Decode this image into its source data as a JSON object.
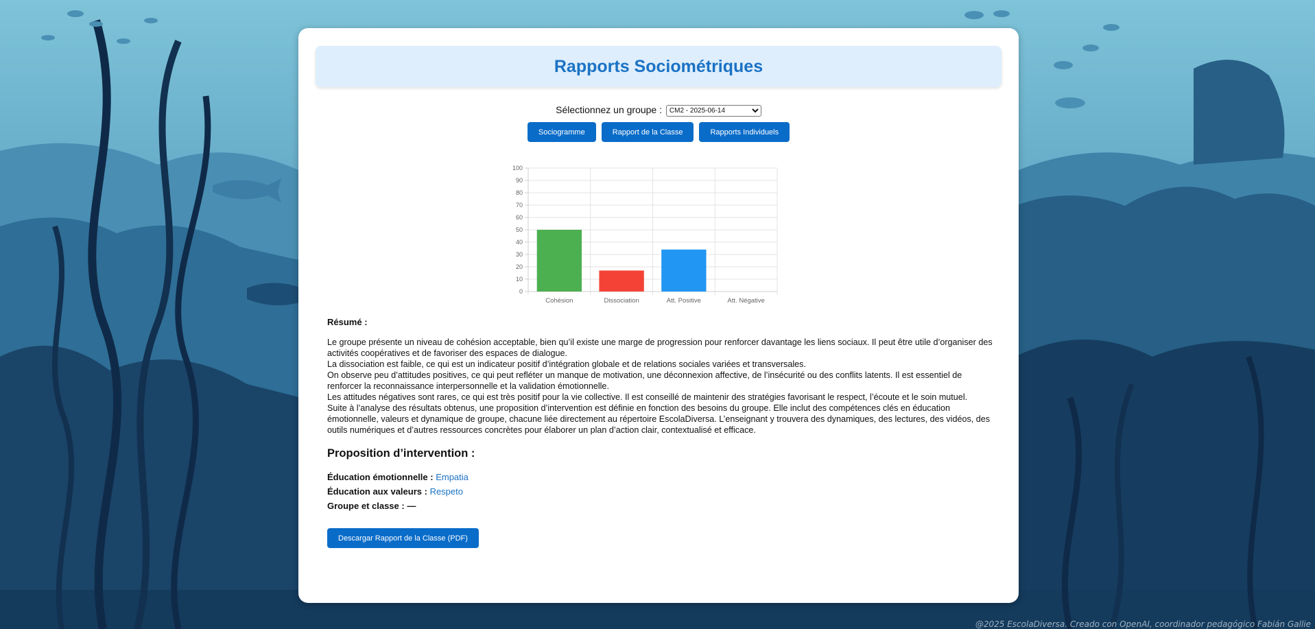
{
  "header": {
    "title": "Rapports Sociométriques"
  },
  "group_select": {
    "label": "Sélectionnez un groupe :",
    "selected": "CM2 - 2025-06-14"
  },
  "buttons": {
    "sociogram": "Sociogramme",
    "class_report": "Rapport de la Classe",
    "individual_reports": "Rapports Individuels"
  },
  "chart_data": {
    "type": "bar",
    "categories": [
      "Cohésion",
      "Dissociation",
      "Att. Positive",
      "Att. Négative"
    ],
    "values": [
      50,
      17,
      34,
      0
    ],
    "colors": [
      "#4caf50",
      "#f44336",
      "#2196f3",
      "#9e9e9e"
    ],
    "ylim": [
      0,
      100
    ],
    "yticks": [
      0,
      10,
      20,
      30,
      40,
      50,
      60,
      70,
      80,
      90,
      100
    ],
    "grid": true
  },
  "summary": {
    "title": "Résumé :",
    "lines": [
      "Le groupe présente un niveau de cohésion acceptable, bien qu’il existe une marge de progression pour renforcer davantage les liens sociaux. Il peut être utile d’organiser des activités coopératives et de favoriser des espaces de dialogue.",
      "La dissociation est faible, ce qui est un indicateur positif d’intégration globale et de relations sociales variées et transversales.",
      "On observe peu d’attitudes positives, ce qui peut refléter un manque de motivation, une déconnexion affective, de l’insécurité ou des conflits latents. Il est essentiel de renforcer la reconnaissance interpersonnelle et la validation émotionnelle.",
      "Les attitudes négatives sont rares, ce qui est très positif pour la vie collective. Il est conseillé de maintenir des stratégies favorisant le respect, l’écoute et le soin mutuel.",
      "Suite à l’analyse des résultats obtenus, une proposition d’intervention est définie en fonction des besoins du groupe. Elle inclut des compétences clés en éducation émotionnelle, valeurs et dynamique de groupe, chacune liée directement au répertoire EscolaDiversa. L’enseignant y trouvera des dynamiques, des lectures, des vidéos, des outils numériques et d’autres ressources concrètes pour élaborer un plan d’action clair, contextualisé et efficace."
    ]
  },
  "proposal": {
    "title": "Proposition d’intervention :",
    "emotional_label": "Éducation émotionnelle :",
    "emotional_link": "Empatia",
    "values_label": "Éducation aux valeurs :",
    "values_link": "Respeto",
    "group_label": "Groupe et classe :",
    "group_value": "—"
  },
  "download_button": "Descargar Rapport de la Classe (PDF)",
  "footer": "@2025 EscolaDiversa. Creado con OpenAI, coordinador pedagógico Fabián Gallie"
}
